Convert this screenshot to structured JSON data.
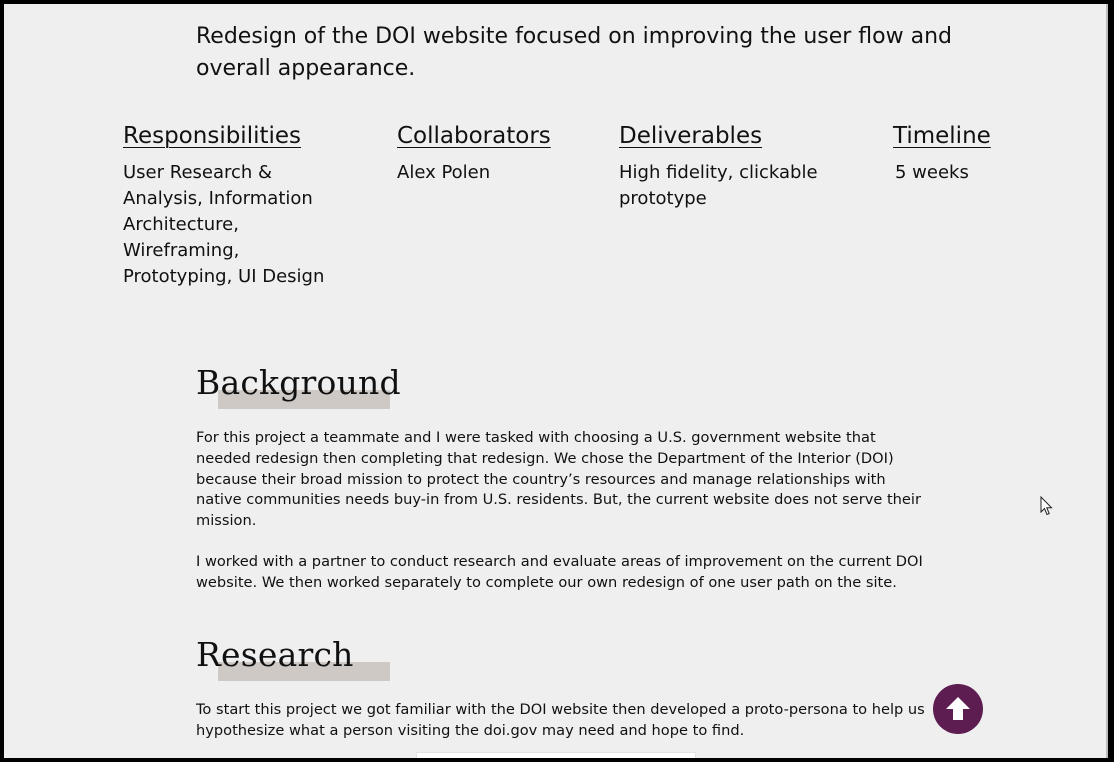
{
  "intro": "Redesign of the DOI website focused on improving the user flow and overall appearance.",
  "info": [
    {
      "heading": "Responsibilities",
      "text": "User Research & Analysis, Information Architecture, Wireframing, Prototyping, UI Design"
    },
    {
      "heading": "Collaborators",
      "text": "Alex Polen"
    },
    {
      "heading": "Deliverables",
      "text": "High fidelity, clickable prototype"
    },
    {
      "heading": "Timeline",
      "text": "5 weeks"
    }
  ],
  "background": {
    "heading": "Background",
    "p1": "For this project a teammate and I were tasked with choosing a U.S. government website that needed redesign then completing that redesign. We chose the Department of the Interior (DOI) because their broad mission to protect the country’s resources and manage relationships with native communities needs buy-in from U.S. residents. But, the current website does not serve their mission.",
    "p2": "I worked with a partner to conduct research and evaluate areas of improvement on the current DOI website. We then worked separately to complete our own redesign of one user path on the site."
  },
  "research": {
    "heading": "Research",
    "p1": "To start this project we got familiar with the DOI website then developed a proto-persona to help us hypothesize what a person visiting the doi.gov may need and hope to find."
  },
  "colors": {
    "accent": "#5d1d50",
    "highlight": "#cfc9c5",
    "page": "#efefef"
  },
  "icons": {
    "scroll_top": "arrow-up-icon",
    "cursor": "mouse-pointer-icon"
  }
}
